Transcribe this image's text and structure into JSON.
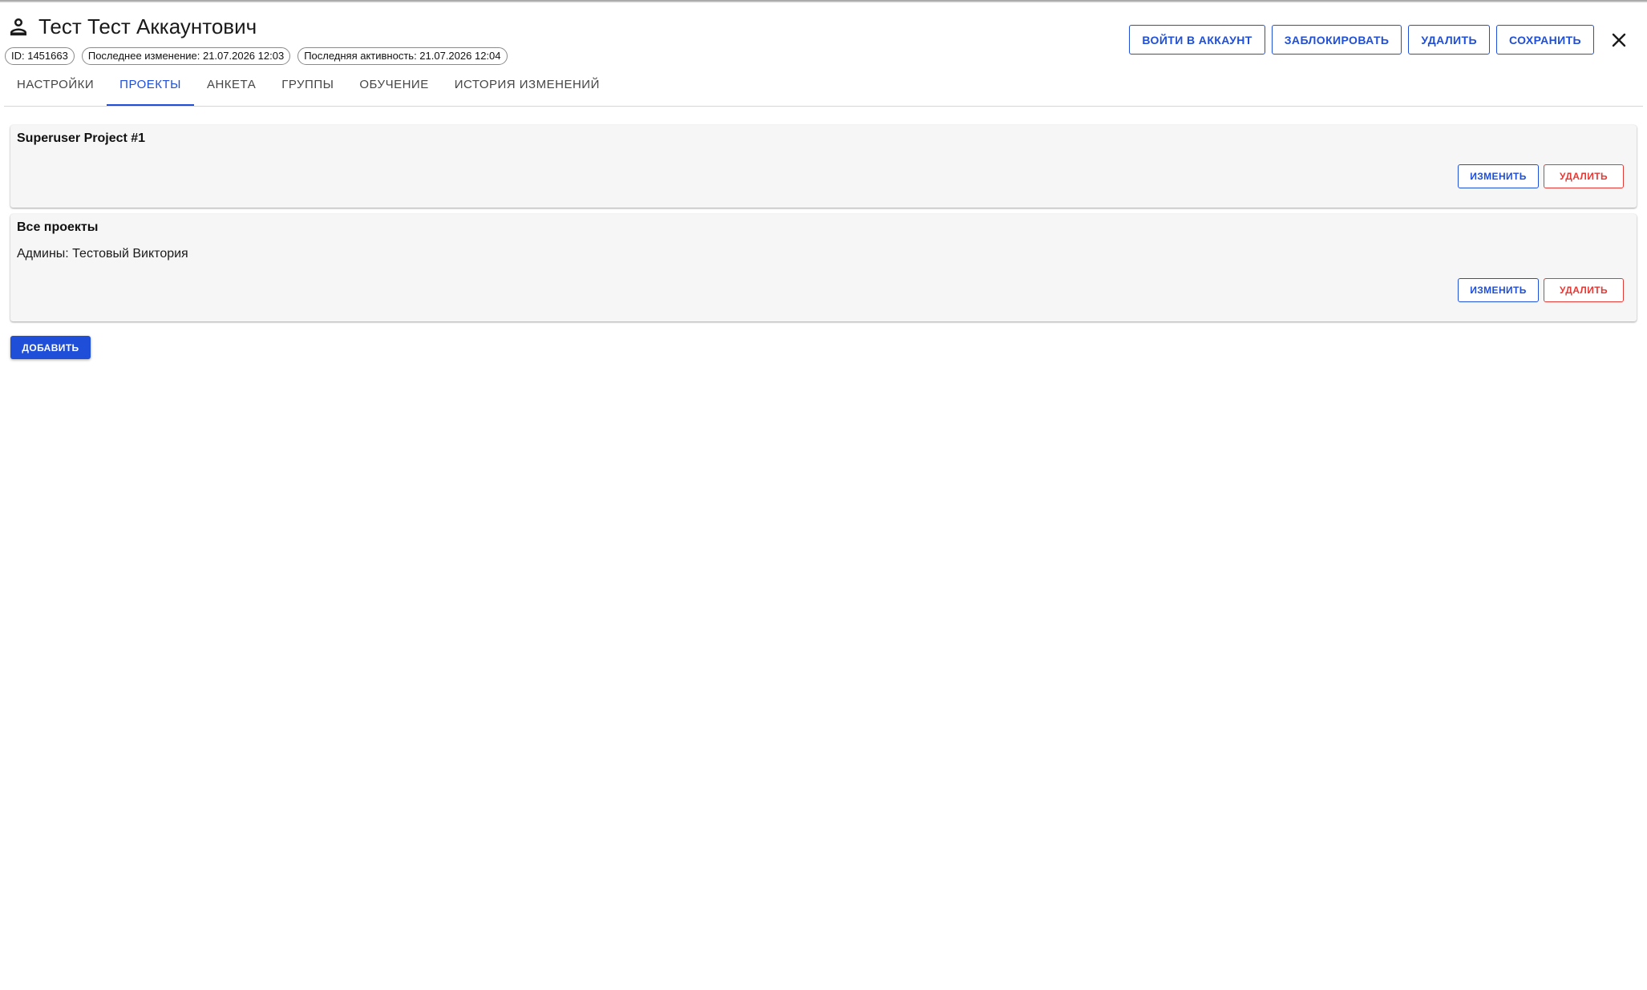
{
  "header": {
    "title": "Тест Тест Аккаунтович",
    "chips": [
      "ID: 1451663",
      "Последнее изменение: 21.07.2026 12:03",
      "Последняя активность: 21.07.2026 12:04"
    ],
    "actions": {
      "login_as": "Войти в аккаунт",
      "block": "Заблокировать",
      "delete": "Удалить",
      "save": "Сохранить"
    },
    "icons": {
      "user": "user-outline-icon",
      "close": "close-icon"
    }
  },
  "tabs": [
    {
      "label": "Настройки",
      "active": false
    },
    {
      "label": "Проекты",
      "active": true
    },
    {
      "label": "Анкета",
      "active": false
    },
    {
      "label": "Группы",
      "active": false
    },
    {
      "label": "Обучение",
      "active": false
    },
    {
      "label": "История изменений",
      "active": false
    }
  ],
  "projects": [
    {
      "name": "Superuser Project #1",
      "admins": "",
      "edit_label": "Изменить",
      "delete_label": "Удалить"
    },
    {
      "name": "Все проекты",
      "admins": "Админы: Тестовый Виктория",
      "edit_label": "Изменить",
      "delete_label": "Удалить"
    }
  ],
  "add_label": "Добавить",
  "colors": {
    "accent": "#1f4ed8",
    "danger": "#e53935",
    "card_bg": "#f6f6f6"
  }
}
